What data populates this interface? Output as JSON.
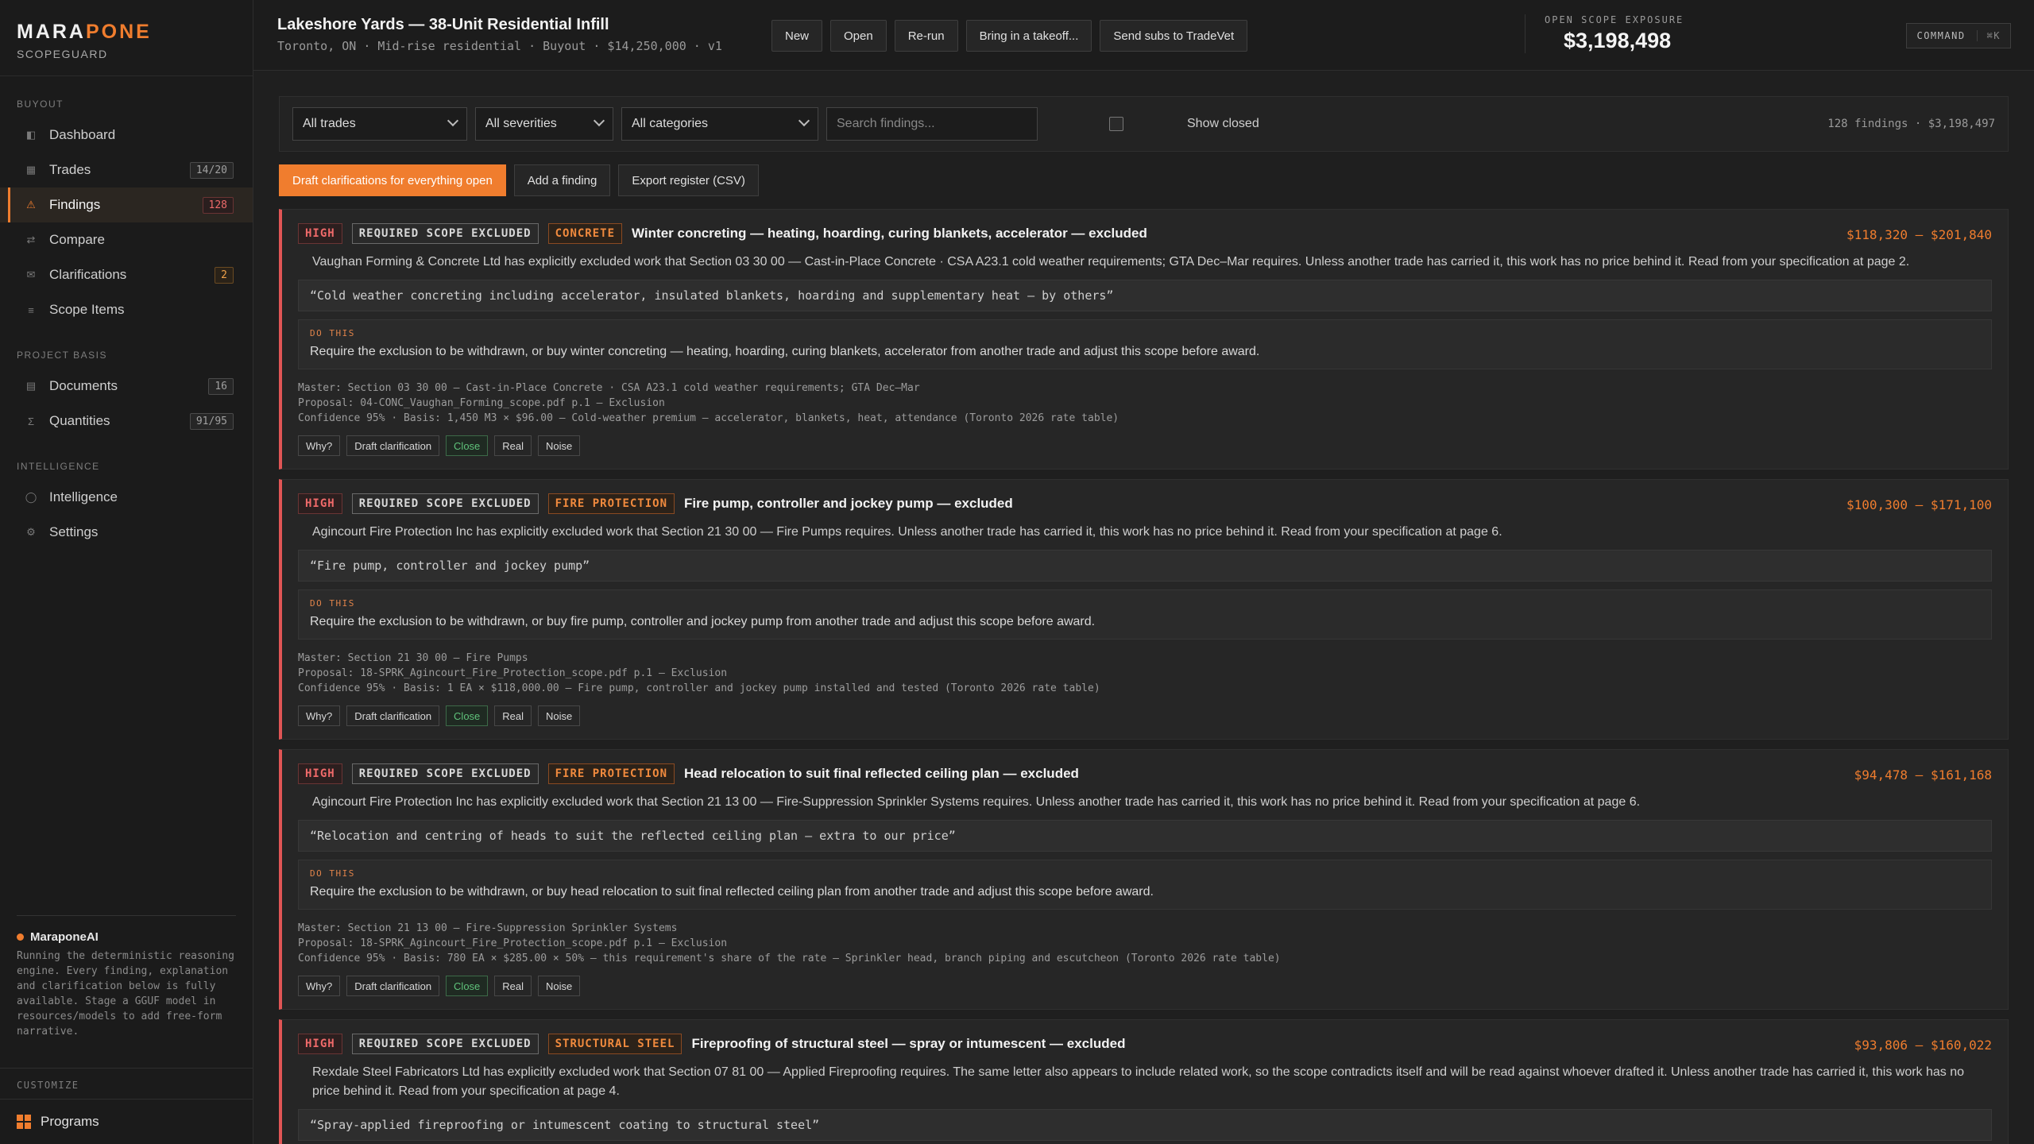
{
  "brand": {
    "name_a": "MARA",
    "name_b": "PONE",
    "sub": "SCOPEGUARD"
  },
  "sidebar": {
    "sections": [
      {
        "label": "BUYOUT"
      },
      {
        "label": "PROJECT BASIS"
      },
      {
        "label": "INTELLIGENCE"
      }
    ],
    "items": [
      {
        "label": "Dashboard",
        "badge": ""
      },
      {
        "label": "Trades",
        "badge": "14/20"
      },
      {
        "label": "Findings",
        "badge": "128"
      },
      {
        "label": "Compare",
        "badge": ""
      },
      {
        "label": "Clarifications",
        "badge": "2"
      },
      {
        "label": "Scope Items",
        "badge": ""
      },
      {
        "label": "Documents",
        "badge": "16"
      },
      {
        "label": "Quantities",
        "badge": "91/95"
      },
      {
        "label": "Intelligence",
        "badge": ""
      },
      {
        "label": "Settings",
        "badge": ""
      }
    ],
    "ai": {
      "title": "MaraponeAI",
      "text": "Running the deterministic reasoning engine. Every finding, explanation and clarification below is fully available. Stage a GGUF model in resources/models to add free-form narrative."
    },
    "customize": "CUSTOMIZE",
    "programs": "Programs"
  },
  "header": {
    "title": "Lakeshore Yards — 38-Unit Residential Infill",
    "meta": "Toronto, ON · Mid-rise residential · Buyout · $14,250,000 · v1",
    "buttons": [
      "New",
      "Open",
      "Re-run",
      "Bring in a takeoff...",
      "Send subs to TradeVet"
    ],
    "exposure_label": "OPEN SCOPE EXPOSURE",
    "exposure_value": "$3,198,498",
    "command_label": "COMMAND",
    "command_kbd": "⌘K"
  },
  "filters": {
    "trades": "All trades",
    "severities": "All severities",
    "categories": "All categories",
    "search_placeholder": "Search findings...",
    "show_closed": "Show closed",
    "count": "128 findings · $3,198,497"
  },
  "actions": {
    "draft_all": "Draft clarifications for everything open",
    "add": "Add a finding",
    "export": "Export register (CSV)"
  },
  "finding_buttons": {
    "why": "Why?",
    "draft": "Draft clarification",
    "close": "Close",
    "real": "Real",
    "noise": "Noise"
  },
  "do_this_label": "DO THIS",
  "findings": [
    {
      "severity": "HIGH",
      "type": "REQUIRED SCOPE EXCLUDED",
      "trade": "CONCRETE",
      "title": "Winter concreting — heating, hoarding, curing blankets, accelerator — excluded",
      "range": "$118,320 – $201,840",
      "desc": "Vaughan Forming & Concrete Ltd has explicitly excluded work that Section 03 30 00 — Cast-in-Place Concrete · CSA A23.1 cold weather requirements; GTA Dec–Mar requires. Unless another trade has carried it, this work has no price behind it. Read from your specification at page 2.",
      "quote": "“Cold weather concreting including accelerator, insulated blankets, hoarding and supplementary heat — by others”",
      "do_this": "Require the exclusion to be withdrawn, or buy winter concreting — heating, hoarding, curing blankets, accelerator from another trade and adjust this scope before award.",
      "master": "Master: Section 03 30 00 — Cast-in-Place Concrete · CSA A23.1 cold weather requirements; GTA Dec–Mar",
      "proposal": "Proposal: 04-CONC_Vaughan_Forming_scope.pdf p.1 — Exclusion",
      "confidence": "Confidence 95% · Basis: 1,450 M3 × $96.00 — Cold-weather premium — accelerator, blankets, heat, attendance (Toronto 2026 rate table)"
    },
    {
      "severity": "HIGH",
      "type": "REQUIRED SCOPE EXCLUDED",
      "trade": "FIRE PROTECTION",
      "title": "Fire pump, controller and jockey pump — excluded",
      "range": "$100,300 – $171,100",
      "desc": "Agincourt Fire Protection Inc has explicitly excluded work that Section 21 30 00 — Fire Pumps requires. Unless another trade has carried it, this work has no price behind it. Read from your specification at page 6.",
      "quote": "“Fire pump, controller and jockey pump”",
      "do_this": "Require the exclusion to be withdrawn, or buy fire pump, controller and jockey pump from another trade and adjust this scope before award.",
      "master": "Master: Section 21 30 00 — Fire Pumps",
      "proposal": "Proposal: 18-SPRK_Agincourt_Fire_Protection_scope.pdf p.1 — Exclusion",
      "confidence": "Confidence 95% · Basis: 1 EA × $118,000.00 — Fire pump, controller and jockey pump installed and tested (Toronto 2026 rate table)"
    },
    {
      "severity": "HIGH",
      "type": "REQUIRED SCOPE EXCLUDED",
      "trade": "FIRE PROTECTION",
      "title": "Head relocation to suit final reflected ceiling plan — excluded",
      "range": "$94,478 – $161,168",
      "desc": "Agincourt Fire Protection Inc has explicitly excluded work that Section 21 13 00 — Fire-Suppression Sprinkler Systems requires. Unless another trade has carried it, this work has no price behind it. Read from your specification at page 6.",
      "quote": "“Relocation and centring of heads to suit the reflected ceiling plan — extra to our price”",
      "do_this": "Require the exclusion to be withdrawn, or buy head relocation to suit final reflected ceiling plan from another trade and adjust this scope before award.",
      "master": "Master: Section 21 13 00 — Fire-Suppression Sprinkler Systems",
      "proposal": "Proposal: 18-SPRK_Agincourt_Fire_Protection_scope.pdf p.1 — Exclusion",
      "confidence": "Confidence 95% · Basis: 780 EA × $285.00 × 50% — this requirement's share of the rate — Sprinkler head, branch piping and escutcheon (Toronto 2026 rate table)"
    },
    {
      "severity": "HIGH",
      "type": "REQUIRED SCOPE EXCLUDED",
      "trade": "STRUCTURAL STEEL",
      "title": "Fireproofing of structural steel — spray or intumescent — excluded",
      "range": "$93,806 – $160,022",
      "desc": "Rexdale Steel Fabricators Ltd has explicitly excluded work that Section 07 81 00 — Applied Fireproofing requires. The same letter also appears to include related work, so the scope contradicts itself and will be read against whoever drafted it. Unless another trade has carried it, this work has no price behind it. Read from your specification at page 4.",
      "quote": "“Spray-applied fireproofing or intumescent coating to structural steel”",
      "do_this": "",
      "master": "",
      "proposal": "",
      "confidence": ""
    }
  ]
}
